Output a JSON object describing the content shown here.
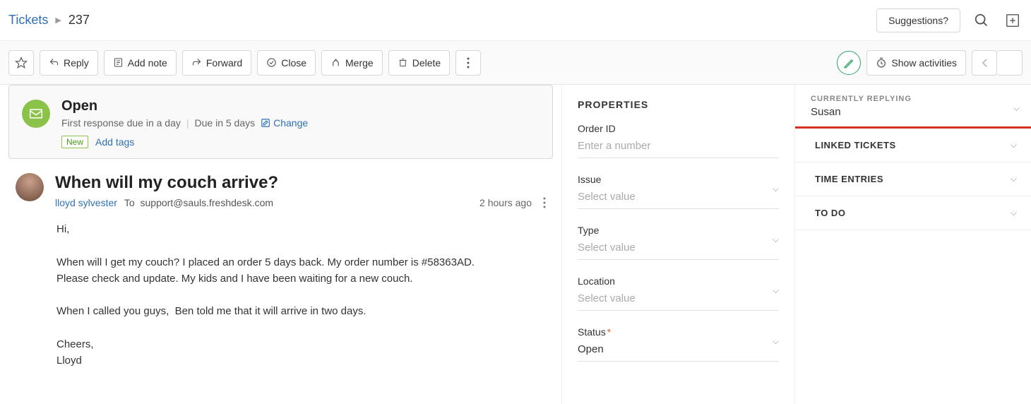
{
  "breadcrumb": {
    "parent": "Tickets",
    "id": "237"
  },
  "header": {
    "suggestions_label": "Suggestions?"
  },
  "toolbar": {
    "reply_label": "Reply",
    "add_note_label": "Add note",
    "forward_label": "Forward",
    "close_label": "Close",
    "merge_label": "Merge",
    "delete_label": "Delete",
    "show_activities_label": "Show activities"
  },
  "status_card": {
    "title": "Open",
    "first_response": "First response due in a day",
    "due_in": "Due in 5 days",
    "change_label": "Change",
    "new_badge": "New",
    "add_tags_label": "Add tags"
  },
  "message": {
    "subject": "When will my couch arrive?",
    "from_name": "lloyd sylvester",
    "to_prefix": "To",
    "to_address": "support@sauls.freshdesk.com",
    "time_ago": "2 hours ago",
    "body": "Hi,\n\nWhen will I get my couch? I placed an order 5 days back. My order number is #58363AD. Please check and update. My kids and I have been waiting for a new couch.\n\nWhen I called you guys,  Ben told me that it will arrive in two days.\n\nCheers,\nLloyd"
  },
  "properties": {
    "heading": "PROPERTIES",
    "order_id": {
      "label": "Order ID",
      "placeholder": "Enter a number"
    },
    "issue": {
      "label": "Issue",
      "placeholder": "Select value"
    },
    "type": {
      "label": "Type",
      "placeholder": "Select value"
    },
    "location": {
      "label": "Location",
      "placeholder": "Select value"
    },
    "status": {
      "label": "Status",
      "value": "Open"
    }
  },
  "sidebar": {
    "currently_replying_label": "CURRENTLY REPLYING",
    "currently_replying_name": "Susan",
    "linked_tickets_label": "LINKED TICKETS",
    "time_entries_label": "TIME ENTRIES",
    "todo_label": "TO DO"
  }
}
